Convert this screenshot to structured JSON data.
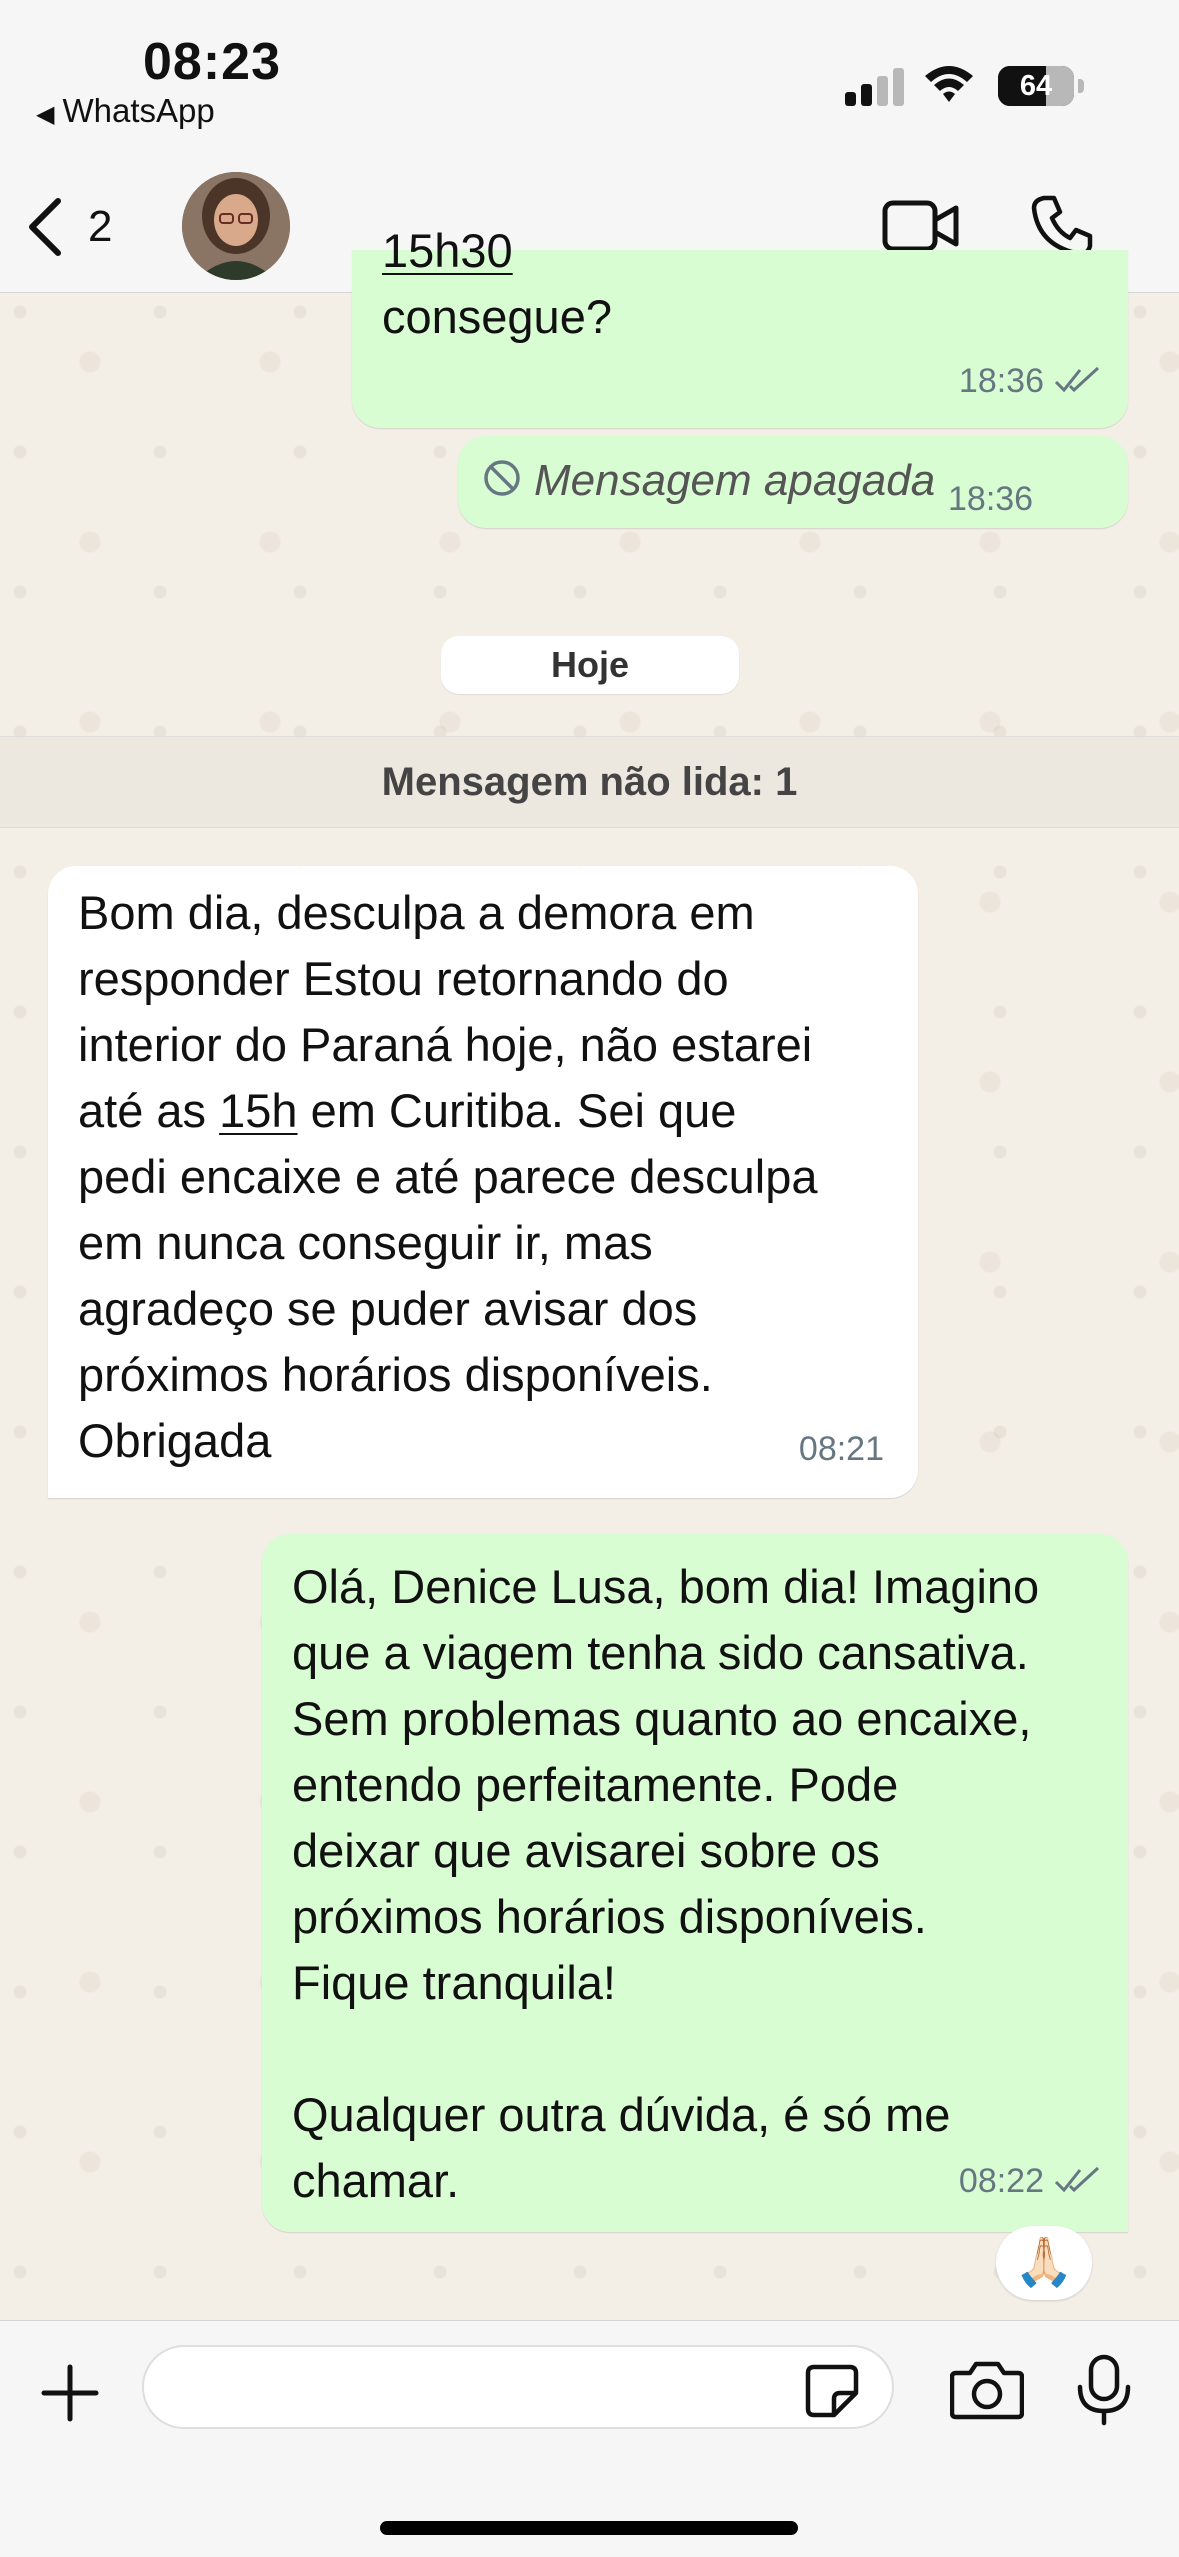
{
  "status_bar": {
    "time": "08:23",
    "back_app": "WhatsApp",
    "battery": "64"
  },
  "header": {
    "back_count": "2"
  },
  "messages": {
    "m1": {
      "lines": [
        "15h30",
        "consegue?"
      ],
      "time": "18:36"
    },
    "m2": {
      "text": "Mensagem apagada",
      "time": "18:36"
    },
    "date_label": "Hoje",
    "unread_label": "Mensagem não lida: 1",
    "m3": {
      "l1": "Bom dia, desculpa a demora em",
      "l2": "responder Estou retornando do",
      "l3": "interior do Paraná hoje, não estarei",
      "l4a": "até as ",
      "l4b": "15h",
      "l4c": " em Curitiba. Sei que",
      "l5": "pedi encaixe e até parece desculpa",
      "l6": "em nunca conseguir ir, mas",
      "l7": "agradeço se puder avisar dos",
      "l8": "próximos horários disponíveis.",
      "l9": "Obrigada",
      "time": "08:21"
    },
    "m4": {
      "l1": "Olá, Denice Lusa, bom dia! Imagino",
      "l2": "que a viagem tenha sido cansativa.",
      "l3": "Sem problemas quanto ao encaixe,",
      "l4": "entendo perfeitamente. Pode",
      "l5": "deixar que avisarei sobre os",
      "l6": "próximos horários disponíveis.",
      "l7": "Fique tranquila!",
      "l8": "Qualquer outra dúvida, é só me",
      "l9": "chamar.",
      "time": "08:22",
      "reaction": "🙏🏻"
    }
  },
  "input": {
    "placeholder": ""
  },
  "colors": {
    "outgoing": "#d9fdd3",
    "incoming": "#ffffff",
    "background": "#efeae2"
  }
}
